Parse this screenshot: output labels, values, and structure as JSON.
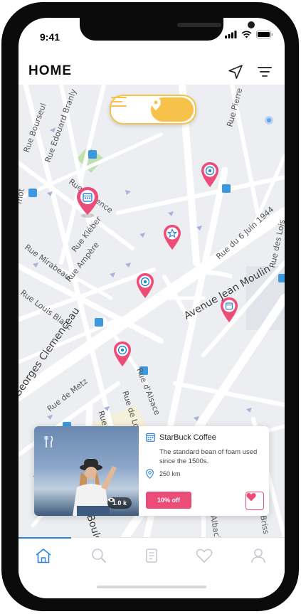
{
  "status": {
    "time": "9:41"
  },
  "header": {
    "title": "HOME"
  },
  "map": {
    "streets": [
      {
        "label": "Rue Bourseul"
      },
      {
        "label": "Rue Edouard Branly"
      },
      {
        "label": "Rue Pierre"
      },
      {
        "label": "Rue Clarence"
      },
      {
        "label": "Rue Kléber"
      },
      {
        "label": "Rue Ampère"
      },
      {
        "label": "Rue Mirabeau"
      },
      {
        "label": "Rue Louis Blanc"
      },
      {
        "label": "Rue du 6 Juin 1944"
      },
      {
        "label": "Rue des Lois"
      },
      {
        "label": "Avenue Jean Moulin"
      },
      {
        "label": "Georges Clemenceau"
      },
      {
        "label": "Rue de Metz"
      },
      {
        "label": "Rue d'Alsace"
      },
      {
        "label": "Rue de Lorr"
      },
      {
        "label": "Rue Del"
      },
      {
        "label": "Boule"
      },
      {
        "label": "Albach"
      },
      {
        "label": "Briss"
      },
      {
        "label": "mot"
      }
    ]
  },
  "toggle": {
    "list_icon": "list-icon",
    "map_icon": "map-pin-icon"
  },
  "card": {
    "name": "StarBuck Coffee",
    "description": "The standard bean of foam used since the 1500s.",
    "distance": "250 km",
    "views": "1.0 k",
    "offer": "10% off"
  },
  "colors": {
    "accent": "#f7c24a",
    "pin": "#ec4c78",
    "active_tab": "#2b84d8"
  },
  "tabs": [
    {
      "icon": "home-icon"
    },
    {
      "icon": "search-icon"
    },
    {
      "icon": "scroll-icon"
    },
    {
      "icon": "heart-icon"
    },
    {
      "icon": "user-icon"
    }
  ]
}
